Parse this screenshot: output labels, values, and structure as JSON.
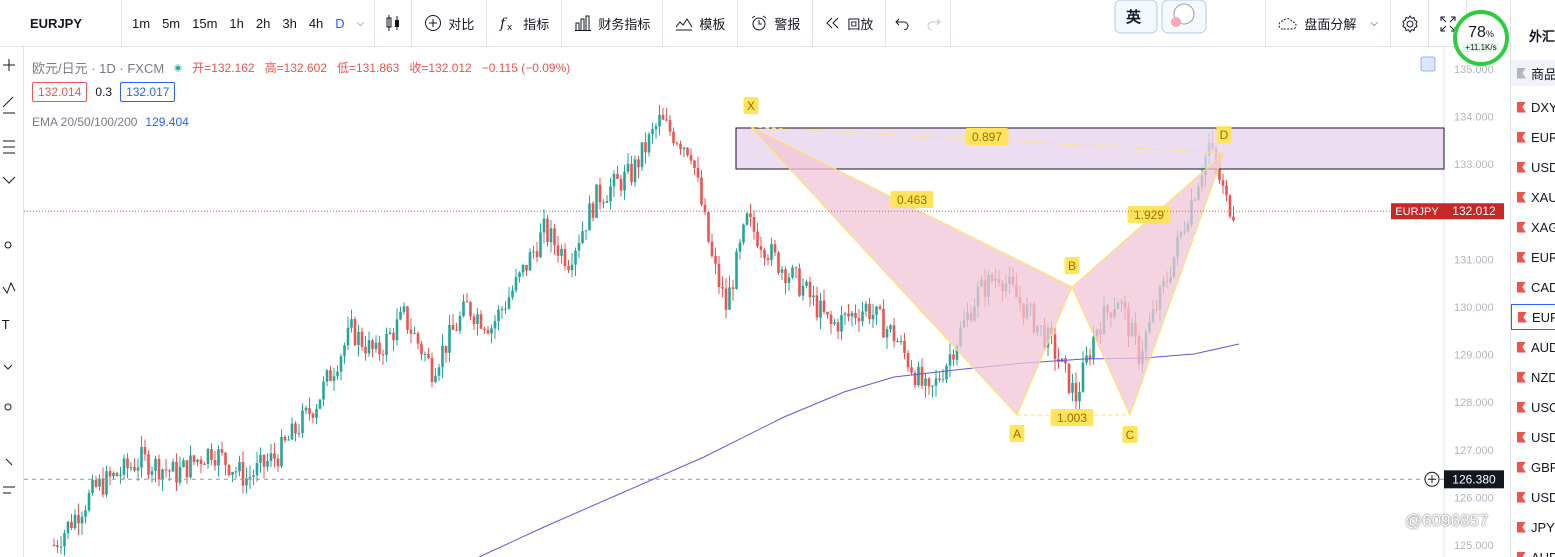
{
  "toolbar": {
    "symbol": "EURJPY",
    "intervals": [
      "1m",
      "5m",
      "15m",
      "1h",
      "2h",
      "3h",
      "4h",
      "D"
    ],
    "active_interval": "D",
    "compare": "对比",
    "indicators": "指标",
    "financials": "财务指标",
    "templates": "模板",
    "alerts": "警报",
    "replay": "回放",
    "split": "盘面分解"
  },
  "legend": {
    "name": "欧元/日元 · 1D · FXCM",
    "open": "开=132.162",
    "high": "高=132.602",
    "low": "低=131.863",
    "close": "收=132.012",
    "change": "−0.115 (−0.09%)",
    "bid": "132.014",
    "spread": "0.3",
    "ask": "132.017",
    "ema_label": "EMA 20/50/100/200",
    "ema_value": "129.404"
  },
  "price_axis": {
    "ticks": [
      "135.000",
      "134.000",
      "133.000",
      "131.000",
      "130.000",
      "129.000",
      "128.000",
      "127.000",
      "126.000",
      "125.000"
    ],
    "ticks_values": [
      135,
      134,
      133,
      131,
      130,
      129,
      128,
      127,
      126,
      125
    ],
    "last_symbol": "EURJPY",
    "last_price": "132.012",
    "crosshair_price": "126.380"
  },
  "pattern": {
    "points": [
      "X",
      "A",
      "B",
      "C",
      "D"
    ],
    "ratios": {
      "xb": "0.463",
      "xd": "0.897",
      "ac": "1.003",
      "bd": "1.929"
    }
  },
  "watchlist": {
    "title": "外汇",
    "group": "商品",
    "items": [
      "DXY",
      "EURUSD",
      "USDJPY",
      "XAUUSD",
      "XAGUSD",
      "EURGBP",
      "CADJPY",
      "EURJPY",
      "AUDUSD",
      "NZDUSD",
      "USOIL",
      "USDCAD",
      "GBPUSD",
      "USDCHF",
      "JPYCAD",
      "AUDJPY"
    ],
    "selected": "EURJPY"
  },
  "gauge": {
    "percent": "78",
    "unit": "%",
    "speed": "+11.1K/s"
  },
  "sticker": {
    "text": "英"
  },
  "watermark": "@6096857",
  "colors": {
    "up": "#26a69a",
    "down": "#ef5350",
    "pattern_fill": "#f0c6d6",
    "zone_fill": "#e9d4ec",
    "ema": "#5b5bd6",
    "label_bg": "#ffe45c"
  }
}
